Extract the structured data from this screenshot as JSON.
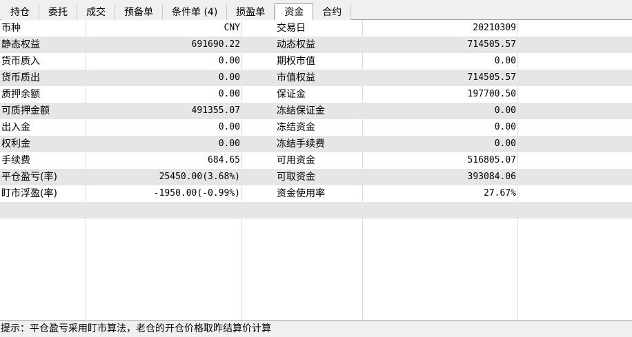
{
  "tabs": [
    {
      "label": "持仓"
    },
    {
      "label": "委托"
    },
    {
      "label": "成交"
    },
    {
      "label": "预备单"
    },
    {
      "label": "条件单 (4)"
    },
    {
      "label": "损盈单"
    },
    {
      "label": "资金"
    },
    {
      "label": "合约"
    }
  ],
  "active_tab": "资金",
  "rows": [
    {
      "l_label": "币种",
      "l_value": "CNY",
      "r_label": "交易日",
      "r_value": "20210309"
    },
    {
      "l_label": "静态权益",
      "l_value": "691690.22",
      "r_label": "动态权益",
      "r_value": "714505.57"
    },
    {
      "l_label": "货币质入",
      "l_value": "0.00",
      "r_label": "期权市值",
      "r_value": "0.00"
    },
    {
      "l_label": "货币质出",
      "l_value": "0.00",
      "r_label": "市值权益",
      "r_value": "714505.57"
    },
    {
      "l_label": "质押余额",
      "l_value": "0.00",
      "r_label": "保证金",
      "r_value": "197700.50"
    },
    {
      "l_label": "可质押金额",
      "l_value": "491355.07",
      "r_label": "冻结保证金",
      "r_value": "0.00"
    },
    {
      "l_label": "出入金",
      "l_value": "0.00",
      "r_label": "冻结资金",
      "r_value": "0.00"
    },
    {
      "l_label": "权利金",
      "l_value": "0.00",
      "r_label": "冻结手续费",
      "r_value": "0.00"
    },
    {
      "l_label": "手续费",
      "l_value": "684.65",
      "r_label": "可用资金",
      "r_value": "516805.07"
    },
    {
      "l_label": "平仓盈亏(率)",
      "l_value": "25450.00(3.68%)",
      "r_label": "可取资金",
      "r_value": "393084.06"
    },
    {
      "l_label": "盯市浮盈(率)",
      "l_value": "-1950.00(-0.99%)",
      "r_label": "资金使用率",
      "r_value": "27.67%"
    }
  ],
  "status_text": "提示：平仓盈亏采用盯市算法，老仓的开仓价格取昨结算价计算"
}
